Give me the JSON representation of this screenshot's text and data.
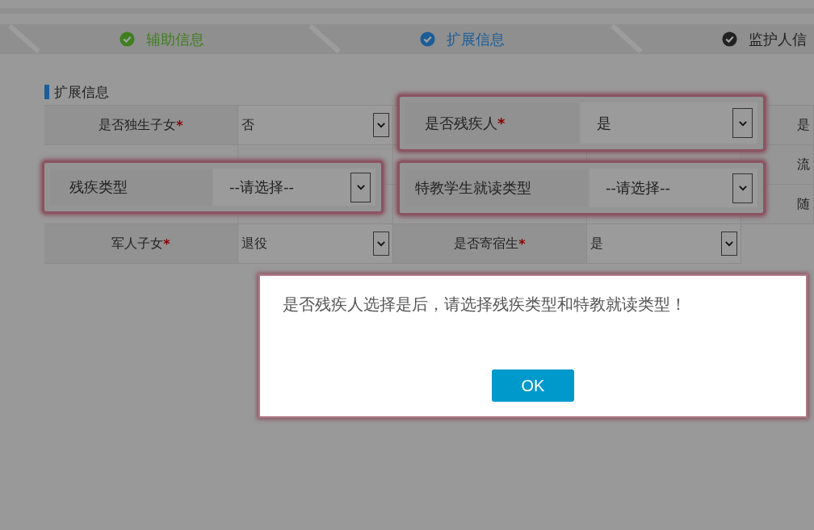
{
  "steps": [
    {
      "label": "辅助信息",
      "color": "#3f7f1e"
    },
    {
      "label": "扩展信息",
      "color": "#1a5d98"
    },
    {
      "label": "监护人信",
      "color": "#222222"
    }
  ],
  "section": {
    "title": "扩展信息"
  },
  "form": {
    "rows": [
      {
        "cells": [
          {
            "kind": "label",
            "text": "是否独生子女",
            "required_mark": "*"
          },
          {
            "kind": "select",
            "value": "否"
          },
          {
            "kind": "covered"
          },
          "",
          {
            "kind": "edge_label",
            "text": "是"
          }
        ]
      },
      {
        "cells": [
          {
            "kind": "covered"
          },
          {
            "kind": "covered"
          },
          {
            "kind": "covered"
          },
          {
            "kind": "covered"
          },
          {
            "kind": "edge_label",
            "text": "流"
          }
        ]
      },
      {
        "cells": [
          {
            "kind": "covered"
          },
          {
            "kind": "covered"
          },
          {
            "kind": "covered"
          },
          {
            "kind": "covered"
          },
          {
            "kind": "edge_label",
            "text": "随"
          }
        ]
      },
      {
        "cells": [
          {
            "kind": "label",
            "text": "军人子女",
            "required_mark": "*"
          },
          {
            "kind": "select",
            "value": "退役"
          },
          {
            "kind": "label",
            "text": "是否寄宿生",
            "required_mark": "*"
          },
          {
            "kind": "select",
            "value": "是"
          }
        ]
      }
    ]
  },
  "highlighted_fields": [
    {
      "label": "是否残疾人",
      "required_mark": "*",
      "value": "是"
    },
    {
      "label": "残疾类型",
      "value": "--请选择--"
    },
    {
      "label": "特教学生就读类型",
      "value": "--请选择--"
    }
  ],
  "dialog": {
    "message": "是否残疾人选择是后，请选择残疾类型和特教就读类型！",
    "button": "OK"
  }
}
